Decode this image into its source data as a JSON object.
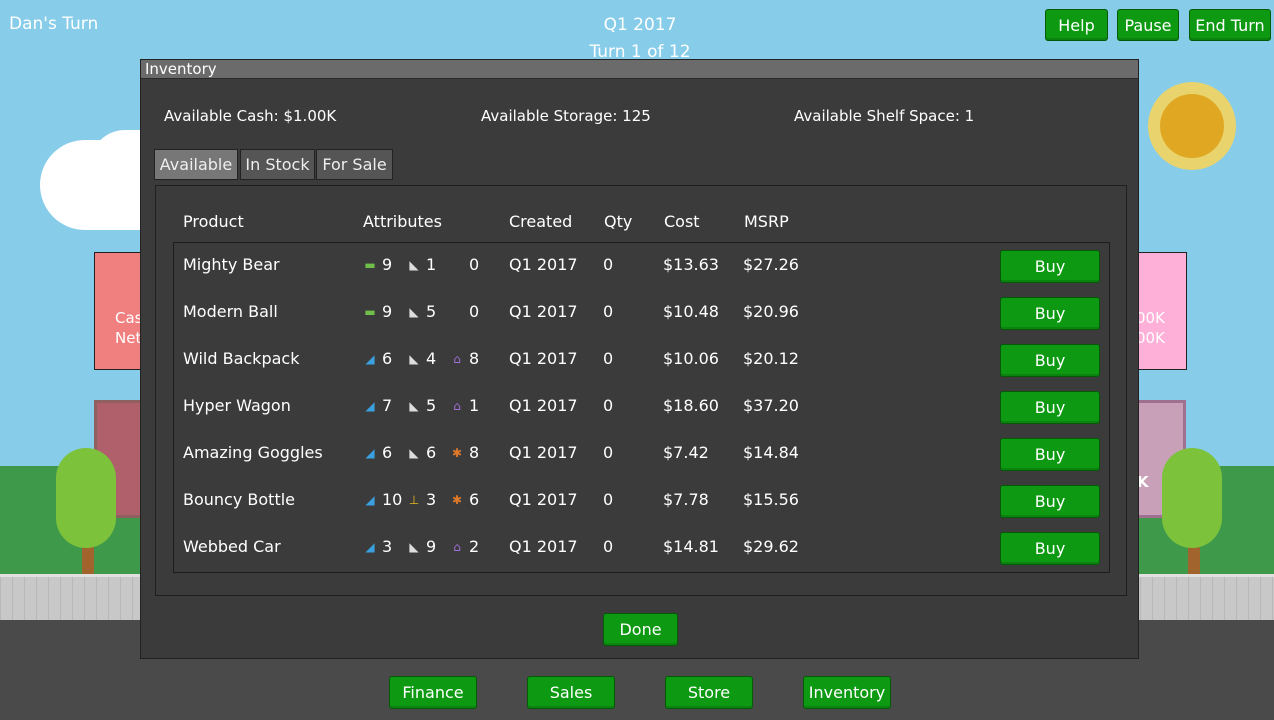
{
  "header": {
    "player_turn": "Dan's Turn",
    "quarter": "Q1 2017",
    "turn": "Turn 1 of 12",
    "help": "Help",
    "pause": "Pause",
    "end_turn": "End Turn"
  },
  "background": {
    "left_store_lines": [
      "Cas",
      "Net"
    ],
    "right_store_lines": [
      "00K",
      "00K"
    ],
    "right_building_label": "K"
  },
  "dialog": {
    "title": "Inventory",
    "available_cash": "Available Cash: $1.00K",
    "available_storage": "Available Storage: 125",
    "available_shelf_space": "Available Shelf Space: 1",
    "tabs": [
      "Available",
      "In Stock",
      "For Sale"
    ],
    "columns": [
      "Product",
      "Attributes",
      "Created",
      "Qty",
      "Cost",
      "MSRP"
    ],
    "buy_label": "Buy",
    "done": "Done",
    "rows": [
      {
        "product": "Mighty Bear",
        "attrs": [
          {
            "icon": "green-bone-icon",
            "color": "#6fbf4a",
            "glyph": "▬",
            "value": "9"
          },
          {
            "icon": "shoe-icon",
            "color": "#dddddd",
            "glyph": "◣",
            "value": "1"
          },
          {
            "icon": "none",
            "color": "#3b3b3b",
            "glyph": "",
            "value": "0"
          }
        ],
        "created": "Q1 2017",
        "qty": "0",
        "cost": "$13.63",
        "msrp": "$27.26"
      },
      {
        "product": "Modern Ball",
        "attrs": [
          {
            "icon": "green-bone-icon",
            "color": "#6fbf4a",
            "glyph": "▬",
            "value": "9"
          },
          {
            "icon": "shoe-icon",
            "color": "#dddddd",
            "glyph": "◣",
            "value": "5"
          },
          {
            "icon": "none",
            "color": "#3b3b3b",
            "glyph": "",
            "value": "0"
          }
        ],
        "created": "Q1 2017",
        "qty": "0",
        "cost": "$10.48",
        "msrp": "$20.96"
      },
      {
        "product": "Wild Backpack",
        "attrs": [
          {
            "icon": "blue-boot-icon",
            "color": "#3aa0e0",
            "glyph": "◢",
            "value": "6"
          },
          {
            "icon": "shoe-icon",
            "color": "#dddddd",
            "glyph": "◣",
            "value": "4"
          },
          {
            "icon": "purple-house-icon",
            "color": "#a070d8",
            "glyph": "⌂",
            "value": "8"
          }
        ],
        "created": "Q1 2017",
        "qty": "0",
        "cost": "$10.06",
        "msrp": "$20.12"
      },
      {
        "product": "Hyper Wagon",
        "attrs": [
          {
            "icon": "blue-boot-icon",
            "color": "#3aa0e0",
            "glyph": "◢",
            "value": "7"
          },
          {
            "icon": "shoe-icon",
            "color": "#dddddd",
            "glyph": "◣",
            "value": "5"
          },
          {
            "icon": "purple-house-icon",
            "color": "#a070d8",
            "glyph": "⌂",
            "value": "1"
          }
        ],
        "created": "Q1 2017",
        "qty": "0",
        "cost": "$18.60",
        "msrp": "$37.20"
      },
      {
        "product": "Amazing Goggles",
        "attrs": [
          {
            "icon": "blue-boot-icon",
            "color": "#3aa0e0",
            "glyph": "◢",
            "value": "6"
          },
          {
            "icon": "shoe-icon",
            "color": "#dddddd",
            "glyph": "◣",
            "value": "6"
          },
          {
            "icon": "orange-bug-icon",
            "color": "#e07a2a",
            "glyph": "✱",
            "value": "8"
          }
        ],
        "created": "Q1 2017",
        "qty": "0",
        "cost": "$7.42",
        "msrp": "$14.84"
      },
      {
        "product": "Bouncy Bottle",
        "attrs": [
          {
            "icon": "blue-boot-icon",
            "color": "#3aa0e0",
            "glyph": "◢",
            "value": "10"
          },
          {
            "icon": "yellow-trophy-icon",
            "color": "#e6b81e",
            "glyph": "⊥",
            "value": "3"
          },
          {
            "icon": "orange-bug-icon",
            "color": "#e07a2a",
            "glyph": "✱",
            "value": "6"
          }
        ],
        "created": "Q1 2017",
        "qty": "0",
        "cost": "$7.78",
        "msrp": "$15.56"
      },
      {
        "product": "Webbed Car",
        "attrs": [
          {
            "icon": "blue-boot-icon",
            "color": "#3aa0e0",
            "glyph": "◢",
            "value": "3"
          },
          {
            "icon": "shoe-icon",
            "color": "#dddddd",
            "glyph": "◣",
            "value": "9"
          },
          {
            "icon": "purple-house-icon",
            "color": "#a070d8",
            "glyph": "⌂",
            "value": "2"
          }
        ],
        "created": "Q1 2017",
        "qty": "0",
        "cost": "$14.81",
        "msrp": "$29.62"
      }
    ]
  },
  "bottom_nav": [
    "Finance",
    "Sales",
    "Store",
    "Inventory"
  ],
  "colors": {
    "button_green": "#0d9a12",
    "dialog_bg": "#3b3b3b",
    "sky": "#87cdea"
  }
}
